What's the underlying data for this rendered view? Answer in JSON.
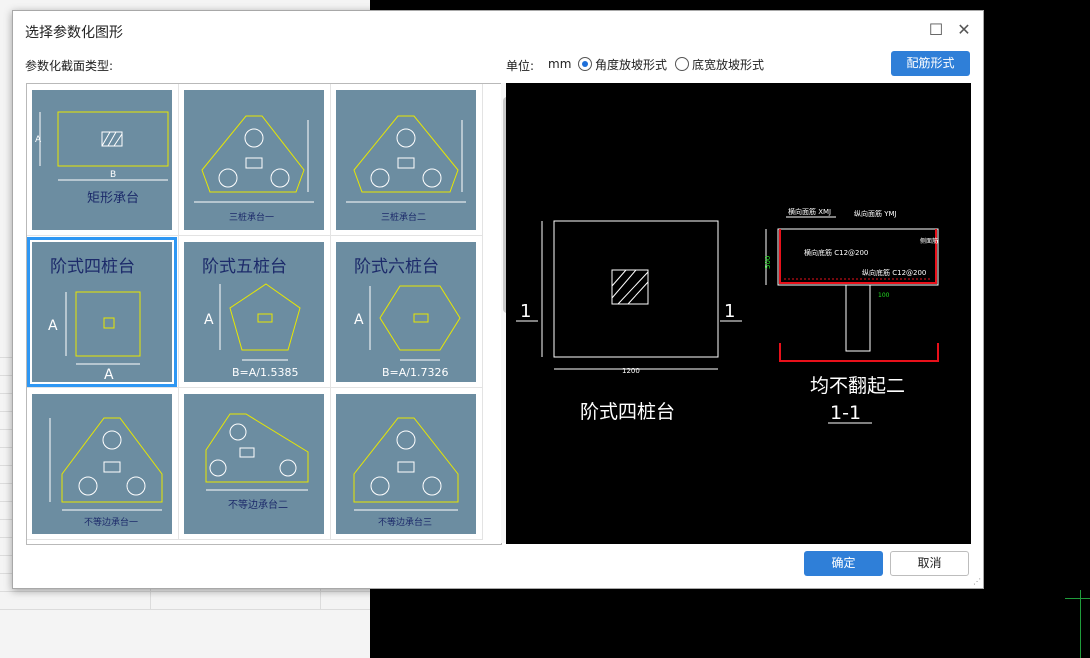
{
  "dialog": {
    "title": "选择参数化图形",
    "section_label": "参数化截面类型:",
    "unit_label": "单位:",
    "unit_value": "mm",
    "radio_options": [
      "角度放坡形式",
      "底宽放坡形式"
    ],
    "selected_radio": 0,
    "rebar_button": "配筋形式",
    "ok_button": "确定",
    "cancel_button": "取消"
  },
  "shapes": [
    {
      "label": "矩形承台",
      "selected": false
    },
    {
      "label": "三桩承台一",
      "selected": false
    },
    {
      "label": "三桩承台二",
      "selected": false
    },
    {
      "label": "阶式四桩台",
      "selected": true
    },
    {
      "label": "阶式五桩台",
      "selected": false
    },
    {
      "label": "阶式六桩台",
      "selected": false
    },
    {
      "label": "不等边承台一",
      "selected": false
    },
    {
      "label": "不等边承台二",
      "selected": false
    },
    {
      "label": "不等边承台三",
      "selected": false
    }
  ],
  "thumb_text": {
    "a": "A",
    "b": "B",
    "b5": "B=A/1.5385",
    "b6": "B=A/1.7326"
  },
  "preview": {
    "section_mark": "1",
    "dimension": "1200",
    "label": "阶式四桩台",
    "section_title": "均不翻起二",
    "section_name": "1-1",
    "height_dim": "500",
    "rebars": {
      "top_x": "横向面筋 XMJ",
      "top_y": "纵向面筋 YMJ",
      "bottom_x": "横向底筋 C12@200",
      "bottom_y": "纵向底筋 C12@200",
      "side": "侧面筋",
      "dim_100": "100"
    }
  },
  "colors": {
    "accent": "#2f7fd8",
    "thumb_bg": "#6c8da1",
    "selection": "#2e97f3",
    "cad_yellow": "#e8e800",
    "cad_red": "#e8101a",
    "cad_green": "#22dd22"
  }
}
